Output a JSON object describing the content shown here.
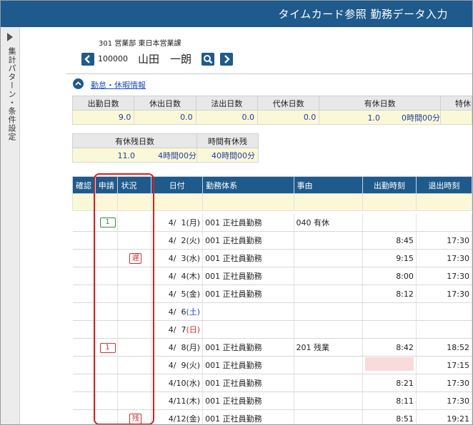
{
  "header": {
    "title": "タイムカード参照  勤務データ入力"
  },
  "sidebar": {
    "label": "集計パターン・条件設定"
  },
  "employee": {
    "org": "301  営業部 東日本営業課",
    "code": "100000",
    "name": "山田　一朗"
  },
  "section": {
    "label": "勤怠・休暇情報"
  },
  "summary1": {
    "headers": [
      "出勤日数",
      "休出日数",
      "法出日数",
      "代休日数",
      "有休日数",
      "特休"
    ],
    "values": [
      "9.0",
      "0.0",
      "0.0",
      "0.0",
      "1.0",
      "0時間00分"
    ]
  },
  "summary2": {
    "headers": [
      "有休残日数",
      "時間有休残"
    ],
    "values": [
      "11.0",
      "4時間00分",
      "40時間00分"
    ]
  },
  "attendance": {
    "headers": [
      "確認",
      "申請",
      "状況",
      "日付",
      "勤務体系",
      "事由",
      "出勤時刻",
      "退出時刻"
    ],
    "rows": [
      {
        "apply": "1",
        "status": "",
        "month": "4/",
        "day": "1",
        "wd": "(月)",
        "wdtype": "",
        "pattern": "001 正社員勤務",
        "reason": "040 有休",
        "in": "",
        "out": "",
        "pink": false
      },
      {
        "apply": "",
        "status": "",
        "month": "4/",
        "day": "2",
        "wd": "(火)",
        "wdtype": "",
        "pattern": "001 正社員勤務",
        "reason": "",
        "in": "8:45",
        "out": "17:30",
        "pink": false
      },
      {
        "apply": "",
        "status": "遅",
        "month": "4/",
        "day": "3",
        "wd": "(水)",
        "wdtype": "",
        "pattern": "001 正社員勤務",
        "reason": "",
        "in": "9:15",
        "out": "17:30",
        "pink": false
      },
      {
        "apply": "",
        "status": "",
        "month": "4/",
        "day": "4",
        "wd": "(木)",
        "wdtype": "",
        "pattern": "001 正社員勤務",
        "reason": "",
        "in": "8:00",
        "out": "17:30",
        "pink": false
      },
      {
        "apply": "",
        "status": "",
        "month": "4/",
        "day": "5",
        "wd": "(金)",
        "wdtype": "",
        "pattern": "001 正社員勤務",
        "reason": "",
        "in": "8:12",
        "out": "17:30",
        "pink": false
      },
      {
        "apply": "",
        "status": "",
        "month": "4/",
        "day": "6",
        "wd": "(土)",
        "wdtype": "sat",
        "pattern": "",
        "reason": "",
        "in": "",
        "out": "",
        "pink": false
      },
      {
        "apply": "",
        "status": "",
        "month": "4/",
        "day": "7",
        "wd": "(日)",
        "wdtype": "sun",
        "pattern": "",
        "reason": "",
        "in": "",
        "out": "",
        "pink": false
      },
      {
        "apply": "1",
        "status": "",
        "month": "4/",
        "day": "8",
        "wd": "(月)",
        "wdtype": "",
        "pattern": "001 正社員勤務",
        "reason": "201 残業",
        "in": "8:42",
        "out": "18:52",
        "pink": false
      },
      {
        "apply": "",
        "status": "",
        "month": "4/",
        "day": "9",
        "wd": "(火)",
        "wdtype": "",
        "pattern": "001 正社員勤務",
        "reason": "",
        "in": "",
        "out": "17:15",
        "pink": true
      },
      {
        "apply": "",
        "status": "",
        "month": "4/",
        "day": "10",
        "wd": "(水)",
        "wdtype": "",
        "pattern": "001 正社員勤務",
        "reason": "",
        "in": "8:21",
        "out": "17:30",
        "pink": false
      },
      {
        "apply": "",
        "status": "",
        "month": "4/",
        "day": "11",
        "wd": "(木)",
        "wdtype": "",
        "pattern": "001 正社員勤務",
        "reason": "",
        "in": "8:11",
        "out": "17:30",
        "pink": false
      },
      {
        "apply": "",
        "status": "残",
        "month": "4/",
        "day": "12",
        "wd": "(金)",
        "wdtype": "",
        "pattern": "001 正社員勤務",
        "reason": "",
        "in": "8:51",
        "out": "19:21",
        "pink": false
      }
    ]
  }
}
